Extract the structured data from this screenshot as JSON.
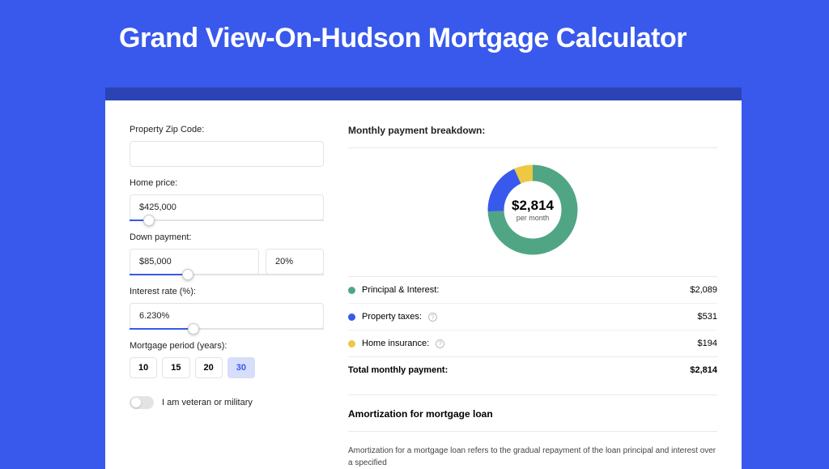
{
  "title": "Grand View-On-Hudson Mortgage Calculator",
  "form": {
    "zip_label": "Property Zip Code:",
    "zip_value": "",
    "home_price_label": "Home price:",
    "home_price_value": "$425,000",
    "down_payment_label": "Down payment:",
    "down_payment_amount": "$85,000",
    "down_payment_pct": "20%",
    "interest_label": "Interest rate (%):",
    "interest_value": "6.230%",
    "period_label": "Mortgage period (years):",
    "periods": [
      "10",
      "15",
      "20",
      "30"
    ],
    "period_selected": "30",
    "veteran_label": "I am veteran or military"
  },
  "breakdown": {
    "heading": "Monthly payment breakdown:",
    "total_amount": "$2,814",
    "total_sub": "per month",
    "rows": [
      {
        "color": "green",
        "label": "Principal & Interest:",
        "value": "$2,089",
        "info": false
      },
      {
        "color": "blue",
        "label": "Property taxes:",
        "value": "$531",
        "info": true
      },
      {
        "color": "yellow",
        "label": "Home insurance:",
        "value": "$194",
        "info": true
      }
    ],
    "total_label": "Total monthly payment:",
    "total_value": "$2,814"
  },
  "amortization": {
    "heading": "Amortization for mortgage loan",
    "body": "Amortization for a mortgage loan refers to the gradual repayment of the loan principal and interest over a specified"
  },
  "chart_data": {
    "type": "pie",
    "title": "Monthly payment breakdown",
    "series": [
      {
        "name": "Principal & Interest",
        "value": 2089,
        "color": "#50A684"
      },
      {
        "name": "Property taxes",
        "value": 531,
        "color": "#3859EC"
      },
      {
        "name": "Home insurance",
        "value": 194,
        "color": "#EDC843"
      }
    ],
    "total": 2814,
    "unit": "USD per month"
  }
}
